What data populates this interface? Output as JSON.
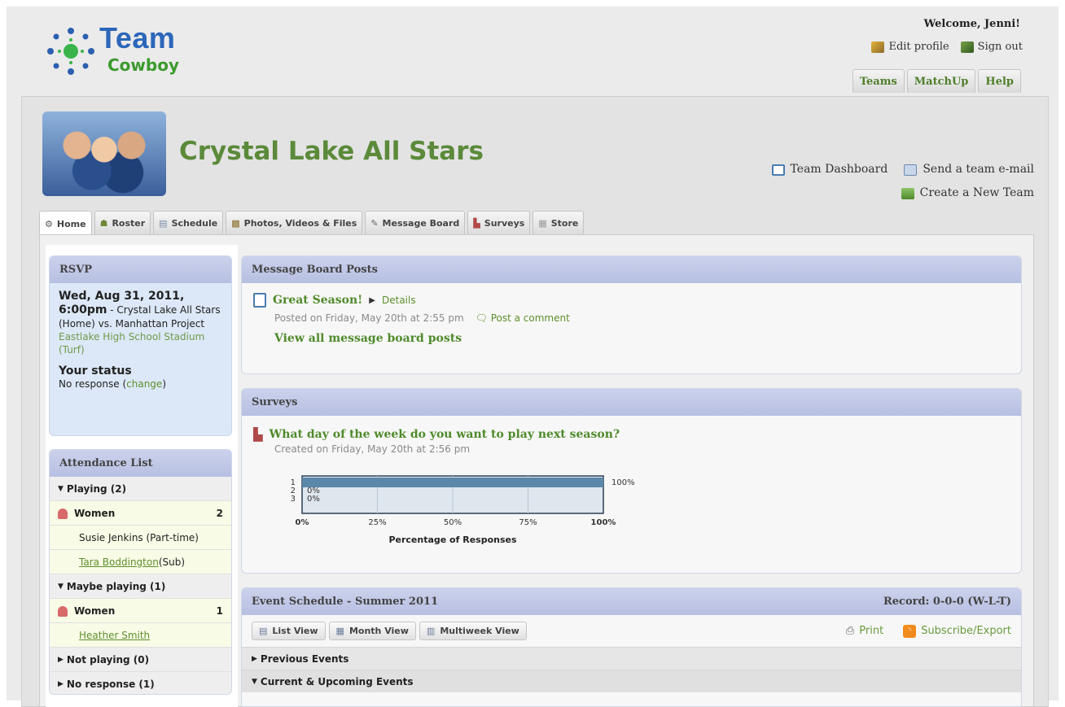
{
  "header": {
    "logo_team": "Team",
    "logo_cowboy": "Cowboy",
    "welcome": "Welcome, Jenni!",
    "edit_profile": "Edit profile",
    "sign_out": "Sign out",
    "top_tabs": [
      "Teams",
      "MatchUp",
      "Help"
    ]
  },
  "team": {
    "name": "Crystal Lake All Stars",
    "dashboard": "Team Dashboard",
    "send_email": "Send a team e-mail",
    "create_team": "Create a New Team"
  },
  "nav_tabs": [
    "Home",
    "Roster",
    "Schedule",
    "Photos, Videos & Files",
    "Message Board",
    "Surveys",
    "Store"
  ],
  "rsvp": {
    "title": "RSVP",
    "date": "Wed, Aug 31, 2011, 6:00pm",
    "matchup": " - Crystal Lake All Stars (Home) vs. Manhattan Project",
    "location": "Eastlake High School Stadium (Turf)",
    "status_label": "Your status",
    "status_value": "No response (",
    "change": "change",
    "close_paren": ")"
  },
  "attendance": {
    "title": "Attendance List",
    "playing": "Playing (2)",
    "playing_cat": "Women",
    "playing_count": "2",
    "playing_members": [
      "Susie Jenkins (Part-time)",
      "Tara Boddington",
      " (Sub)"
    ],
    "maybe": "Maybe playing (1)",
    "maybe_cat": "Women",
    "maybe_count": "1",
    "maybe_member": "Heather Smith",
    "not_playing": "Not playing (0)",
    "no_response": "No response (1)"
  },
  "message_board": {
    "title": "Message Board Posts",
    "post_title": "Great Season!",
    "details": "Details",
    "posted": "Posted on Friday, May 20th at 2:55 pm",
    "comment": "Post a comment",
    "view_all": "View all message board posts"
  },
  "surveys": {
    "title": "Surveys",
    "question": "What day of the week do you want to play next season?",
    "created": "Created on Friday, May 20th at 2:56 pm"
  },
  "chart_data": {
    "type": "bar",
    "orientation": "horizontal",
    "categories": [
      "1",
      "2",
      "3"
    ],
    "values": [
      100,
      0,
      0
    ],
    "value_labels": [
      "100%",
      "0%",
      "0%"
    ],
    "x_ticks": [
      "0%",
      "25%",
      "50%",
      "75%",
      "100%"
    ],
    "xlabel": "Percentage of Responses",
    "xlim": [
      0,
      100
    ],
    "bar_color": "#5b87a8"
  },
  "schedule": {
    "title": "Event Schedule - Summer 2011",
    "record": "Record:  0-0-0 (W-L-T)",
    "views": [
      "List View",
      "Month View",
      "Multiweek View"
    ],
    "print": "Print",
    "subscribe": "Subscribe/Export",
    "previous": "Previous Events",
    "current": "Current & Upcoming Events"
  },
  "colors": {
    "accent_green": "#5b8a3a",
    "logo_blue": "#2b66b8",
    "header_bar": "#b7bfe2"
  }
}
